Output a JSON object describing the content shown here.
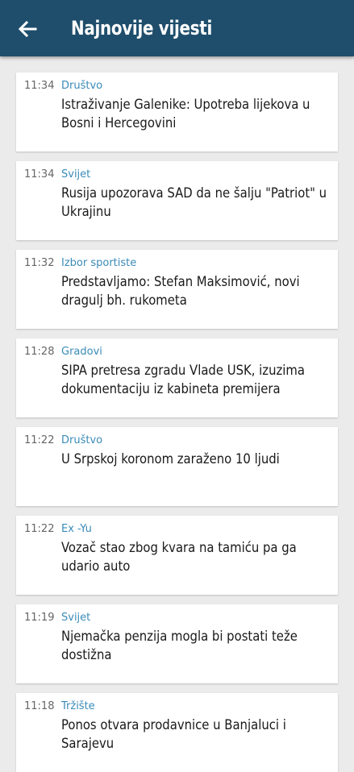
{
  "header": {
    "title": "Najnovije vijesti",
    "back_icon": "arrow-left-icon",
    "color": "#1f4e6c"
  },
  "accent_color": "#3a8bb8",
  "news": [
    {
      "time": "11:34",
      "category": "Društvo",
      "title": "Istraživanje Galenike: Upotreba lijekova u Bosni i Hercegovini"
    },
    {
      "time": "11:34",
      "category": "Svijet",
      "title": "Rusija upozorava SAD da ne šalju \"Patriot\" u Ukrajinu"
    },
    {
      "time": "11:32",
      "category": "Izbor sportiste",
      "title": "Predstavljamo: Stefan Maksimović, novi dragulj bh. rukometa"
    },
    {
      "time": "11:28",
      "category": "Gradovi",
      "title": "SIPA pretresa zgradu Vlade USK, izuzima dokumentaciju iz kabineta premijera"
    },
    {
      "time": "11:22",
      "category": "Društvo",
      "title": "U Srpskoj koronom zaraženo 10 ljudi"
    },
    {
      "time": "11:22",
      "category": "Ex -Yu",
      "title": "Vozač stao zbog kvara na tamiću pa ga udario auto"
    },
    {
      "time": "11:19",
      "category": "Svijet",
      "title": "Njemačka penzija mogla bi postati teže dostižna"
    },
    {
      "time": "11:18",
      "category": "Tržište",
      "title": "Ponos otvara prodavnice u Banjaluci i Sarajevu"
    }
  ]
}
